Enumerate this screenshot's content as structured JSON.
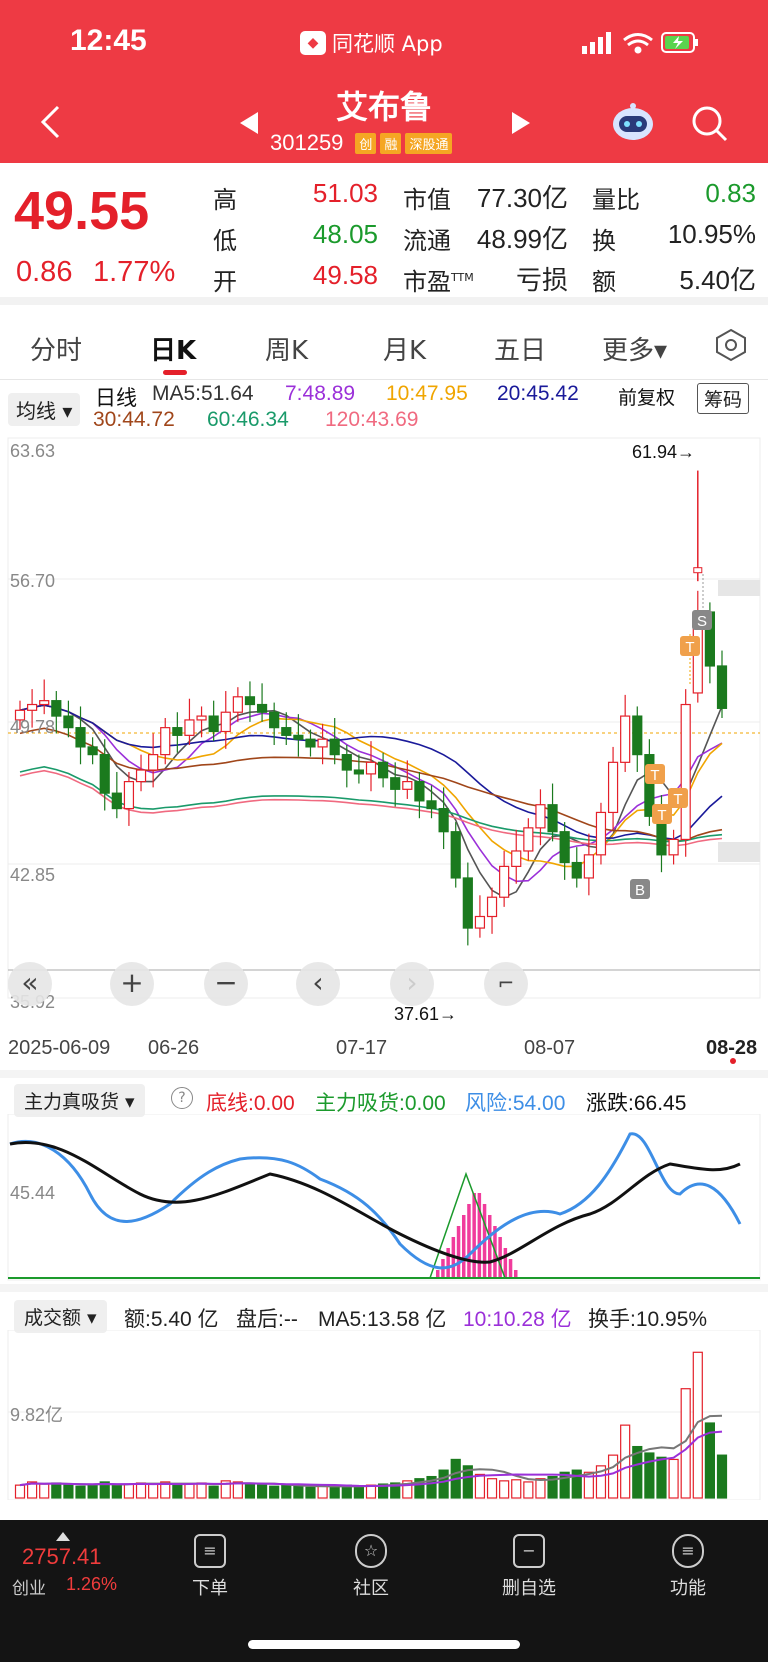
{
  "status_bar": {
    "time": "12:45",
    "app": "同花顺 App"
  },
  "header": {
    "name": "艾布鲁",
    "code": "301259",
    "tags": [
      "创",
      "融",
      "深股通"
    ]
  },
  "quote": {
    "price": "49.55",
    "change": "0.86",
    "change_pct": "1.77%",
    "high_label": "高",
    "high": "51.03",
    "low_label": "低",
    "low": "48.05",
    "open_label": "开",
    "open": "49.58",
    "mcap_label": "市值",
    "mcap": "77.30亿",
    "float_label": "流通",
    "float": "48.99亿",
    "pe_label": "市盈",
    "pe_sup": "TTM",
    "pe": "亏损",
    "vr_label": "量比",
    "vr": "0.83",
    "turn_label": "换",
    "turn": "10.95%",
    "amt_label": "额",
    "amt": "5.40亿"
  },
  "tabs": [
    "分时",
    "日K",
    "周K",
    "月K",
    "五日",
    "更多▾"
  ],
  "ma_bar": {
    "selector": "均线 ▾",
    "period": "日线",
    "ma5": "MA5:51.64",
    "ma7": "7:48.89",
    "ma10": "10:47.95",
    "ma20": "20:45.42",
    "ma30": "30:44.72",
    "ma60": "60:46.34",
    "ma120": "120:43.69",
    "adjust": "前复权",
    "chips": "筹码"
  },
  "kline": {
    "y_labels": [
      "63.63",
      "56.70",
      "49.78",
      "42.85",
      "35.92"
    ],
    "high_mark": "61.94→",
    "low_mark": "37.61→",
    "dates": [
      "2025-06-09",
      "06-26",
      "07-17",
      "08-07",
      "08-28"
    ],
    "markers": [
      "S",
      "T",
      "T",
      "T",
      "T",
      "B"
    ]
  },
  "indicator": {
    "selector": "主力真吸货 ▾",
    "help": "?",
    "base": "底线:0.00",
    "absorb": "主力吸货:0.00",
    "risk": "风险:54.00",
    "updown": "涨跌:66.45",
    "y_label": "45.44"
  },
  "volume": {
    "selector": "成交额 ▾",
    "amt": "额:5.40 亿",
    "after": "盘后:--",
    "ma5": "MA5:13.58 亿",
    "ma10": "10:10.28 亿",
    "turnover": "换手:10.95%",
    "y_label": "9.82亿"
  },
  "nav": {
    "index_value": "2757.41",
    "index_name": "创业",
    "index_pct": "1.26%",
    "items": [
      "下单",
      "社区",
      "删自选",
      "功能"
    ]
  },
  "colors": {
    "up": "#E4202A",
    "down": "#1B7A1E",
    "header": "#EE3A44"
  }
}
